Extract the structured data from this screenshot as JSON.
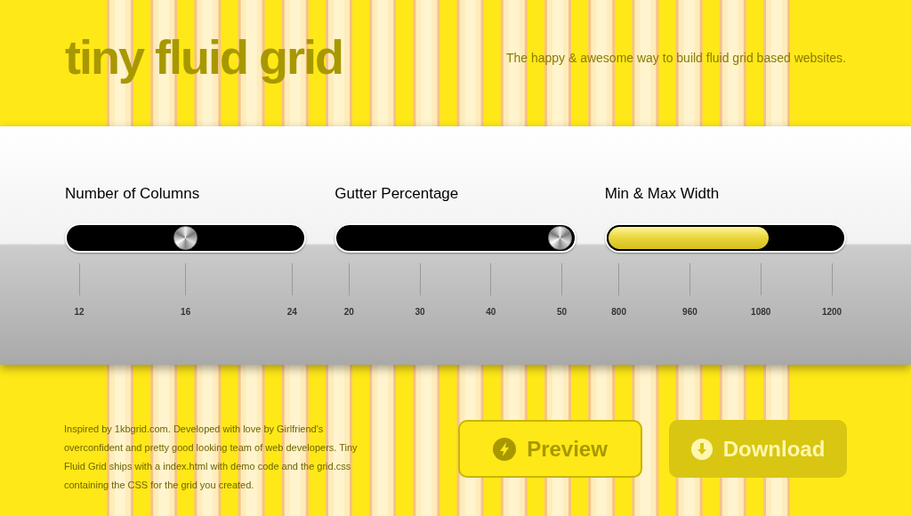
{
  "header": {
    "logo": "tiny fluid grid",
    "tagline": "The happy & awesome way to build fluid grid based websites."
  },
  "sliders": [
    {
      "label": "Number of Columns",
      "kind": "knob",
      "level": 0.5,
      "ticks": [
        "12",
        "16",
        "24"
      ]
    },
    {
      "label": "Gutter Percentage",
      "kind": "knob",
      "level": 0.94,
      "ticks": [
        "20",
        "30",
        "40",
        "50"
      ]
    },
    {
      "label": "Min & Max Width",
      "kind": "range",
      "level": 0.69,
      "ticks": [
        "800",
        "960",
        "1080",
        "1200"
      ]
    }
  ],
  "footer": {
    "text": "Inspired by 1kbgrid.com. Developed with love by Girlfriend's overconfident and pretty good looking team of web developers. Tiny Fluid Grid ships with a index.html with demo code and the grid.css containing the CSS for the grid you created.",
    "buttons": [
      {
        "label": "Preview",
        "kind": "outline"
      },
      {
        "label": "Download",
        "kind": "filled"
      }
    ]
  }
}
